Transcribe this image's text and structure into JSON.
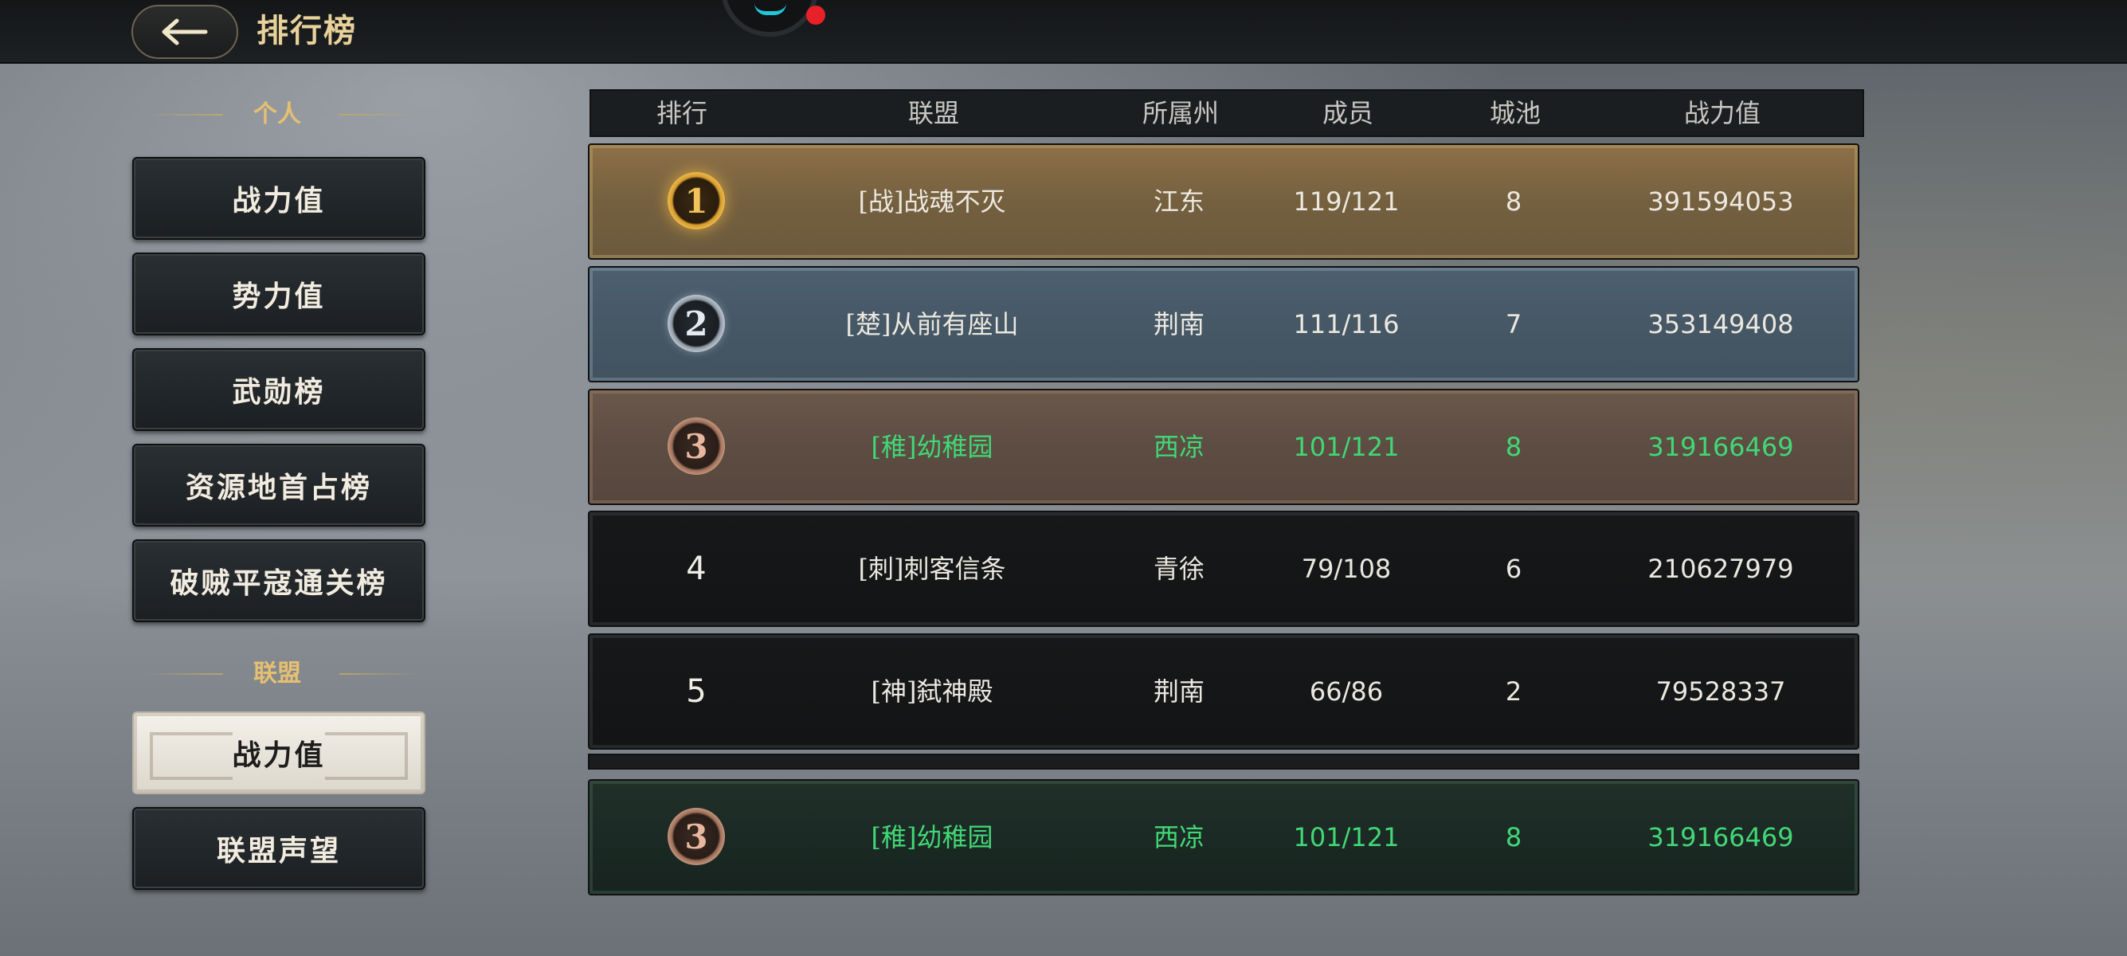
{
  "header": {
    "title": "排行榜",
    "back_icon": "back-arrow-icon"
  },
  "colors": {
    "accent_gold": "#e8d29a",
    "highlight_green": "#42d776"
  },
  "sidebar": {
    "personal_label": "个人",
    "personal_items": [
      "战力值",
      "势力值",
      "武勋榜",
      "资源地首占榜",
      "破贼平寇通关榜"
    ],
    "alliance_label": "联盟",
    "alliance_items": [
      "战力值",
      "联盟声望"
    ],
    "active_item": "联盟-战力值"
  },
  "table": {
    "columns": [
      "排行",
      "联盟",
      "所属州",
      "成员",
      "城池",
      "战力值"
    ],
    "rows": [
      {
        "rank": "1",
        "alliance": "[战]战魂不灭",
        "province": "江东",
        "members": "119/121",
        "cities": "8",
        "power": "391594053"
      },
      {
        "rank": "2",
        "alliance": "[楚]从前有座山",
        "province": "荆南",
        "members": "111/116",
        "cities": "7",
        "power": "353149408"
      },
      {
        "rank": "3",
        "alliance": "[稚]幼稚园",
        "province": "西凉",
        "members": "101/121",
        "cities": "8",
        "power": "319166469"
      },
      {
        "rank": "4",
        "alliance": "[刺]刺客信条",
        "province": "青徐",
        "members": "79/108",
        "cities": "6",
        "power": "210627979"
      },
      {
        "rank": "5",
        "alliance": "[神]弑神殿",
        "province": "荆南",
        "members": "66/86",
        "cities": "2",
        "power": "79528337"
      }
    ],
    "my_alliance": {
      "rank": "3",
      "alliance": "[稚]幼稚园",
      "province": "西凉",
      "members": "101/121",
      "cities": "8",
      "power": "319166469"
    }
  }
}
